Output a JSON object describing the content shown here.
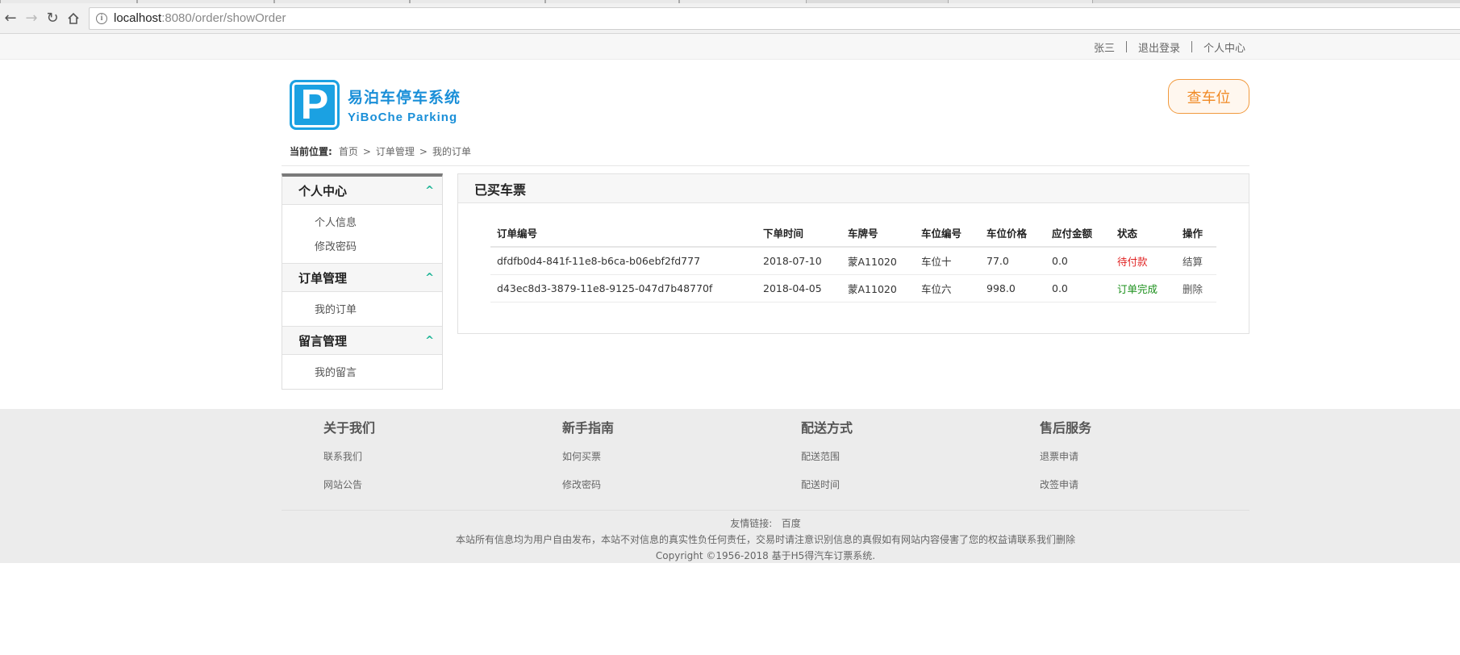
{
  "browser": {
    "url_host": "localhost",
    "url_path": ":8080/order/showOrder"
  },
  "topbar": {
    "user": "张三",
    "logout": "退出登录",
    "profile": "个人中心"
  },
  "header": {
    "logo_letter": "P",
    "logo_cn": "易泊车停车系统",
    "logo_en": "YiBoChe  Parking",
    "find_button": "查车位"
  },
  "breadcrumb": {
    "label": "当前位置:",
    "items": [
      "首页",
      "订单管理",
      "我的订单"
    ],
    "sep": ">"
  },
  "sidebar": {
    "groups": [
      {
        "title": "个人中心",
        "items": [
          "个人信息",
          "修改密码"
        ]
      },
      {
        "title": "订单管理",
        "items": [
          "我的订单"
        ]
      },
      {
        "title": "留言管理",
        "items": [
          "我的留言"
        ]
      }
    ],
    "chevron": "^"
  },
  "panel": {
    "title": "已买车票",
    "columns": [
      "订单编号",
      "下单时间",
      "车牌号",
      "车位编号",
      "车位价格",
      "应付金额",
      "状态",
      "操作"
    ],
    "rows": [
      {
        "id": "dfdfb0d4-841f-11e8-b6ca-b06ebf2fd777",
        "time": "2018-07-10",
        "plate": "蒙A11020",
        "spot": "车位十",
        "price": "77.0",
        "due": "0.0",
        "status": "待付款",
        "status_type": "pending",
        "action": "结算"
      },
      {
        "id": "d43ec8d3-3879-11e8-9125-047d7b48770f",
        "time": "2018-04-05",
        "plate": "蒙A11020",
        "spot": "车位六",
        "price": "998.0",
        "due": "0.0",
        "status": "订单完成",
        "status_type": "done",
        "action": "删除"
      }
    ]
  },
  "footer": {
    "columns": [
      {
        "title": "关于我们",
        "links": [
          "联系我们",
          "网站公告"
        ]
      },
      {
        "title": "新手指南",
        "links": [
          "如何买票",
          "修改密码"
        ]
      },
      {
        "title": "配送方式",
        "links": [
          "配送范围",
          "配送时间"
        ]
      },
      {
        "title": "售后服务",
        "links": [
          "退票申请",
          "改签申请"
        ]
      }
    ],
    "friend_label": "友情链接:",
    "friend_link": "百度",
    "disclaimer": "本站所有信息均为用户自由发布，本站不对信息的真实性负任何责任，交易时请注意识别信息的真假如有网站内容侵害了您的权益请联系我们删除",
    "copyright": "Copyright ©1956-2018 基于H5得汽车订票系统."
  },
  "colors": {
    "brand_blue": "#1ba1e2",
    "accent_orange": "#f08a24",
    "status_pending": "#e02020",
    "status_done": "#1a8f1a",
    "chevron_green": "#1ab394"
  }
}
